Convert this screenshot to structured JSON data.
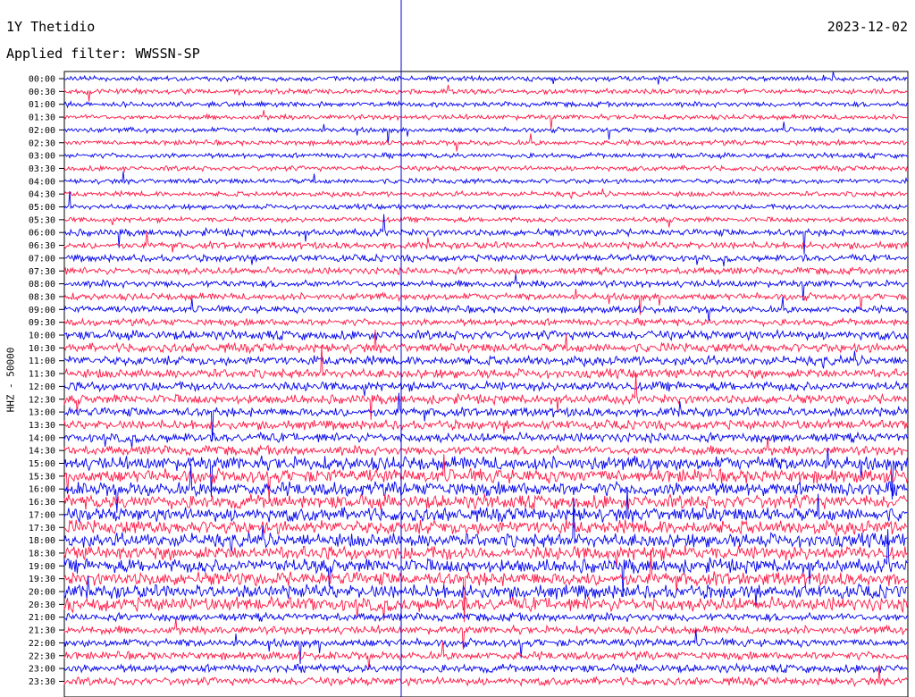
{
  "header": {
    "station": "1Y Thetidio",
    "date": "2023-12-02",
    "filter": "Applied filter: WWSSN-SP"
  },
  "colors": {
    "trace_a": "#0000ee",
    "trace_b": "#ff1744",
    "marker": "#0000cc"
  },
  "chart_data": {
    "type": "line",
    "subtype": "helicorder",
    "ylabel": "HHZ - 50000",
    "row_interval_minutes": 30,
    "row_labels": [
      "00:00",
      "00:30",
      "01:00",
      "01:30",
      "02:00",
      "02:30",
      "03:00",
      "03:30",
      "04:00",
      "04:30",
      "05:00",
      "05:30",
      "06:00",
      "06:30",
      "07:00",
      "07:30",
      "08:00",
      "08:30",
      "09:00",
      "09:30",
      "10:00",
      "10:30",
      "11:00",
      "11:30",
      "12:00",
      "12:30",
      "13:00",
      "13:30",
      "14:00",
      "14:30",
      "15:00",
      "15:30",
      "16:00",
      "16:30",
      "17:00",
      "17:30",
      "18:00",
      "18:30",
      "19:00",
      "19:30",
      "20:00",
      "20:30",
      "21:00",
      "21:30",
      "22:00",
      "22:30",
      "23:00",
      "23:30"
    ],
    "trace_color_cycle": [
      "blue",
      "red"
    ],
    "grid": false,
    "current_time_marker": true
  }
}
